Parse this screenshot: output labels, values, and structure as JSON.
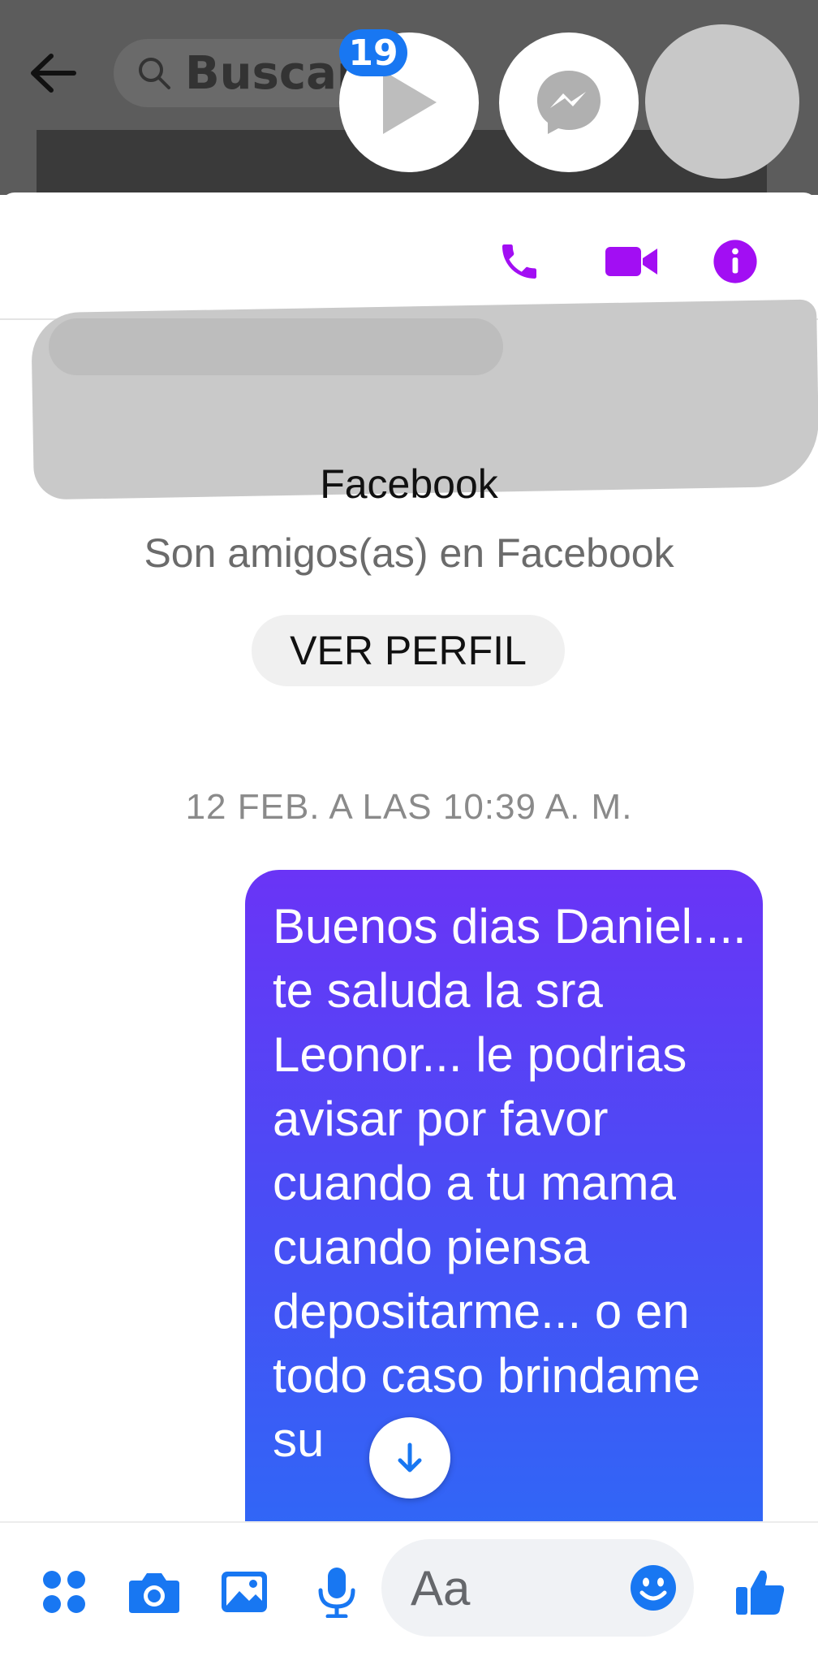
{
  "colors": {
    "accent_purple": "#a20ef3",
    "messenger_blue": "#1877f2",
    "bubble_gradient_top": "#6a34f6",
    "bubble_gradient_bottom": "#2b6cf6"
  },
  "background_app": {
    "search_text": "Buscar"
  },
  "chat_heads": {
    "video_badge": "19"
  },
  "header": {
    "icons": [
      "phone-icon",
      "video-camera-icon",
      "info-icon"
    ]
  },
  "profile": {
    "name": "Facebook",
    "relationship": "Son amigos(as) en Facebook",
    "view_profile_label": "VER PERFIL"
  },
  "thread": {
    "timestamp": "12 FEB. A LAS 10:39 A. M.",
    "messages": [
      {
        "sender": "me",
        "text": "Buenos dias Daniel.... te saluda la sra Leonor... le podrias avisar por favor cuando a tu mama cuando piensa depositarme... o en todo caso brindame su"
      }
    ]
  },
  "composer": {
    "placeholder": "Aa",
    "icons": [
      "apps-icon",
      "camera-icon",
      "gallery-icon",
      "microphone-icon",
      "emoji-icon",
      "thumbs-up-icon"
    ]
  }
}
